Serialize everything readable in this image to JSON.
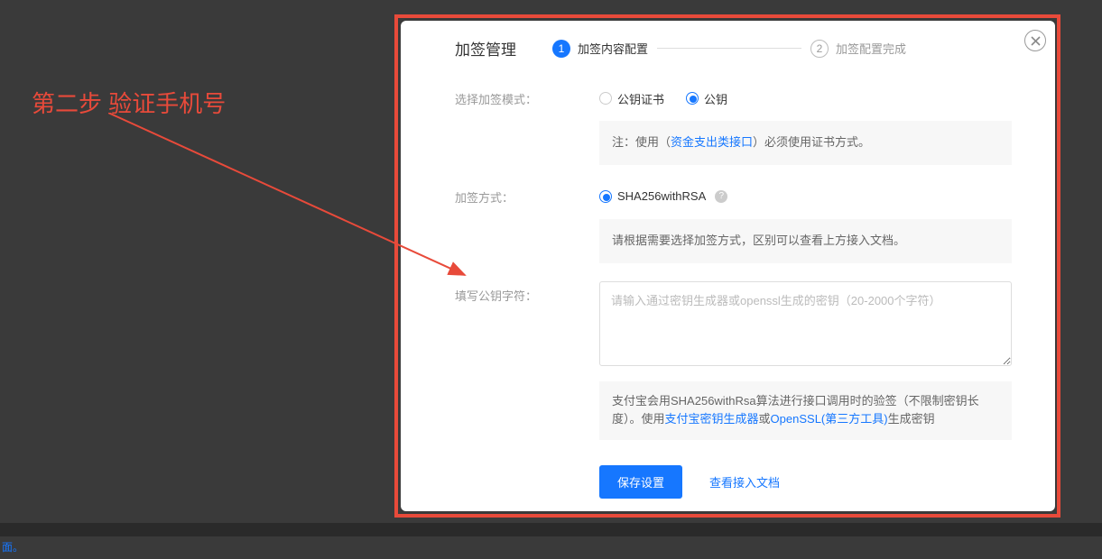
{
  "annotation": "第二步 验证手机号",
  "modal": {
    "title": "加签管理",
    "steps": [
      {
        "num": "1",
        "label": "加签内容配置"
      },
      {
        "num": "2",
        "label": "加签配置完成"
      }
    ],
    "mode": {
      "label": "选择加签模式：",
      "options": [
        {
          "label": "公钥证书",
          "selected": false
        },
        {
          "label": "公钥",
          "selected": true
        }
      ],
      "note_prefix": "注：使用（",
      "note_link": "资金支出类接口",
      "note_suffix": "）必须使用证书方式。"
    },
    "signType": {
      "label": "加签方式：",
      "option": "SHA256withRSA",
      "note": "请根据需要选择加签方式，区别可以查看上方接入文档。"
    },
    "publicKey": {
      "label": "填写公钥字符：",
      "placeholder": "请输入通过密钥生成器或openssl生成的密钥（20-2000个字符）",
      "help_p1": "支付宝会用SHA256withRsa算法进行接口调用时的验签（不限制密钥长度）。使用",
      "help_link1": "支付宝密钥生成器",
      "help_mid": "或",
      "help_link2": "OpenSSL(第三方工具)",
      "help_p2": "生成密钥"
    },
    "buttons": {
      "save": "保存设置",
      "viewDoc": "查看接入文档"
    }
  },
  "footerText": "面。"
}
